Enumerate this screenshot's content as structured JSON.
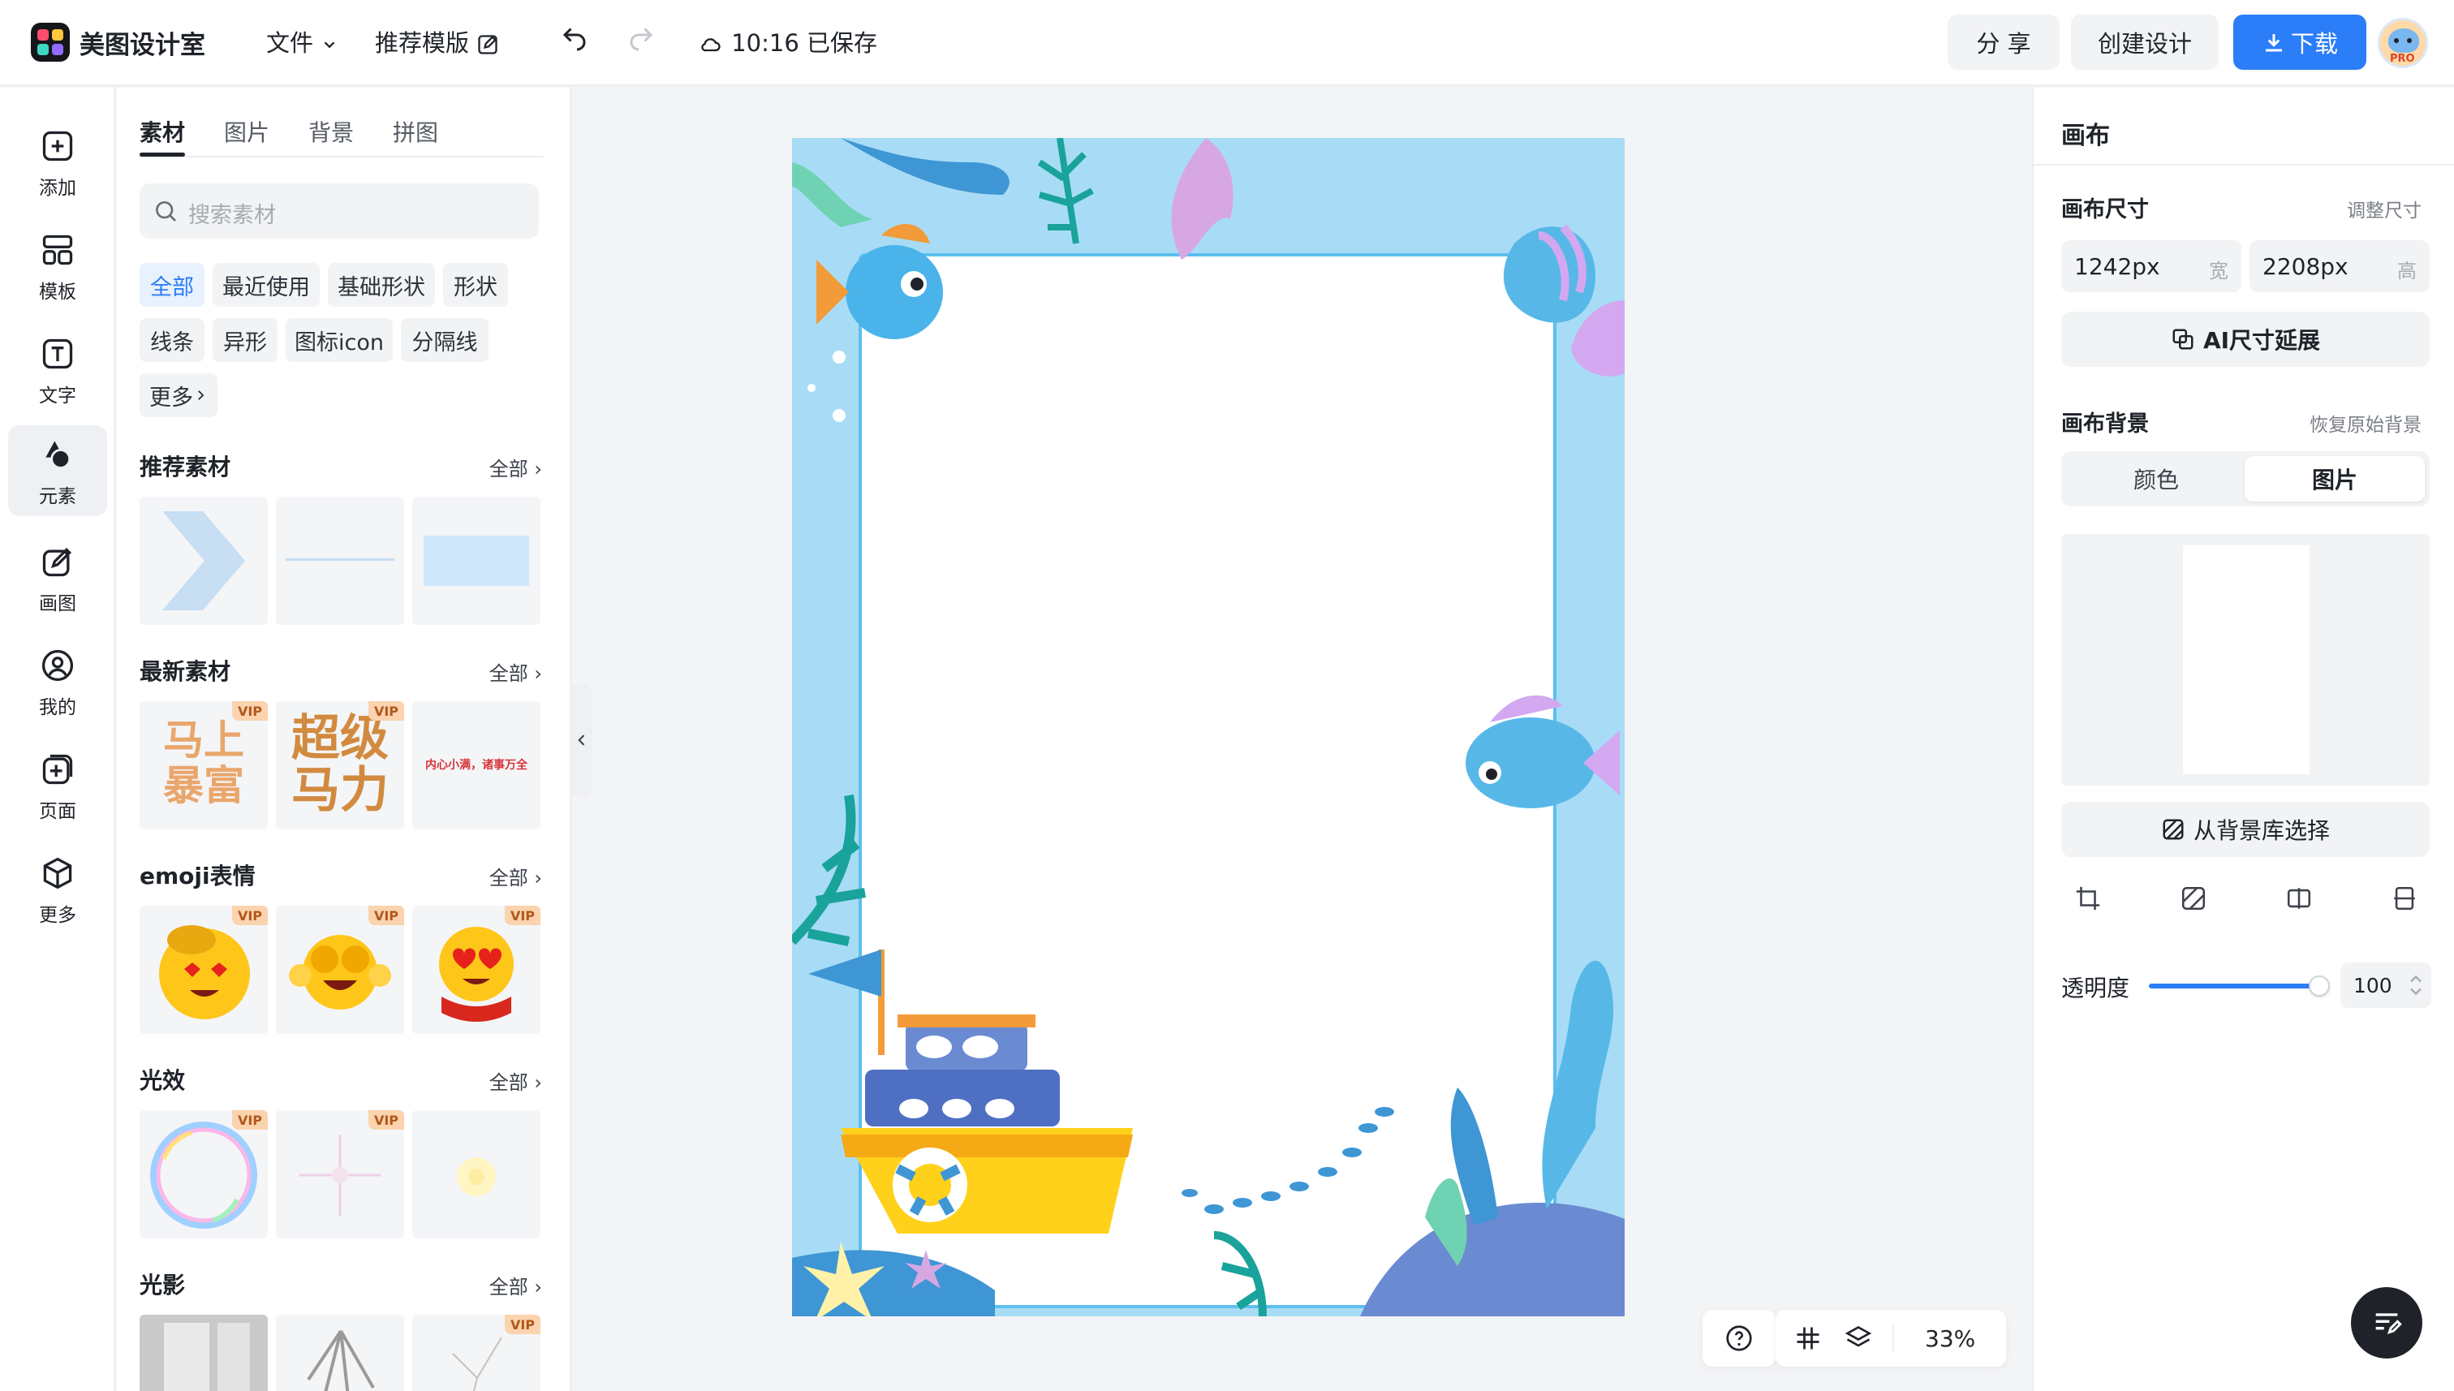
{
  "app": {
    "name": "美图设计室"
  },
  "topbar": {
    "file_menu": "文件",
    "recommend_template": "推荐模版",
    "save_status": "10:16 已保存",
    "share": "分 享",
    "create_design": "创建设计",
    "download": "下载",
    "avatar_badge": "PRO"
  },
  "rail": {
    "items": [
      {
        "label": "添加",
        "icon": "plus-square-icon"
      },
      {
        "label": "模板",
        "icon": "template-icon"
      },
      {
        "label": "文字",
        "icon": "text-icon"
      },
      {
        "label": "元素",
        "icon": "shapes-icon",
        "active": true
      },
      {
        "label": "画图",
        "icon": "draw-icon"
      },
      {
        "label": "我的",
        "icon": "user-icon"
      },
      {
        "label": "页面",
        "icon": "page-add-icon"
      },
      {
        "label": "更多",
        "icon": "cube-icon"
      }
    ]
  },
  "panel": {
    "tabs": [
      "素材",
      "图片",
      "背景",
      "拼图"
    ],
    "search_placeholder": "搜索素材",
    "filters": [
      "全部",
      "最近使用",
      "基础形状",
      "形状",
      "线条",
      "异形",
      "图标icon",
      "分隔线",
      "更多"
    ],
    "all_label": "全部",
    "vip": "VIP",
    "sections": [
      {
        "title": "推荐素材"
      },
      {
        "title": "最新素材",
        "texts": [
          "马上暴富",
          "超级马力",
          "内心小满，诸事万全"
        ]
      },
      {
        "title": "emoji表情"
      },
      {
        "title": "光效"
      },
      {
        "title": "光影"
      }
    ]
  },
  "canvas_toolbar": {
    "zoom": "33%"
  },
  "right_panel": {
    "title": "画布",
    "size_label": "画布尺寸",
    "resize_link": "调整尺寸",
    "width_value": "1242px",
    "width_unit": "宽",
    "height_value": "2208px",
    "height_unit": "高",
    "ai_extend": "AI尺寸延展",
    "bg_label": "画布背景",
    "restore_bg": "恢复原始背景",
    "seg_color": "颜色",
    "seg_image": "图片",
    "from_library": "从背景库选择",
    "opacity_label": "透明度",
    "opacity_value": "100",
    "opacity_level": 1.0
  },
  "colors": {
    "accent": "#2b7df8",
    "canvas_bg": "#a8dcf6",
    "frame": "#5cbfee"
  }
}
